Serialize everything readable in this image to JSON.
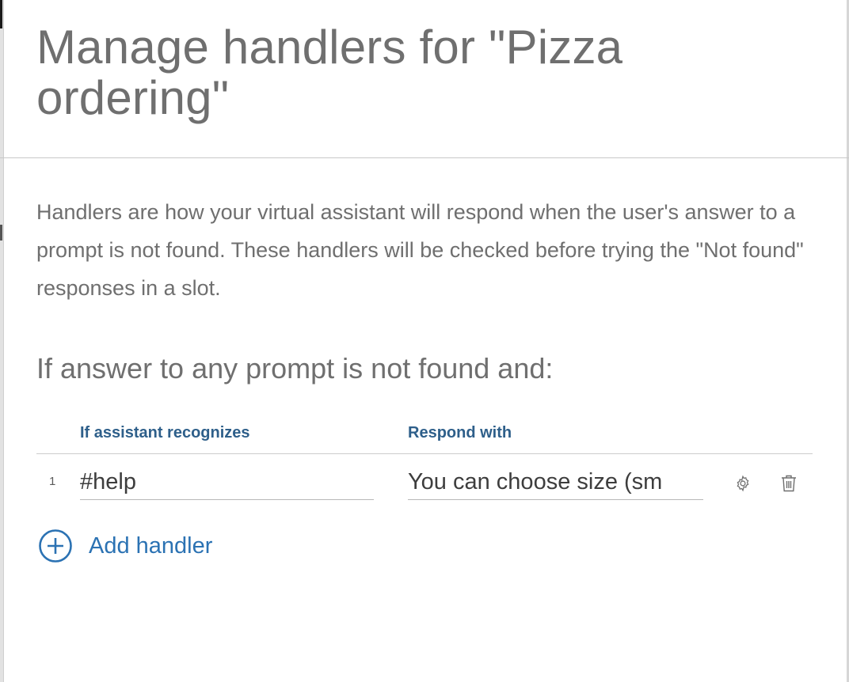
{
  "title": "Manage handlers for \"Pizza ordering\"",
  "description": "Handlers are how your virtual assistant will respond when the user's answer to a prompt is not found. These handlers will be checked before trying the \"Not found\" responses in a slot.",
  "section_heading": "If answer to any prompt is not found and:",
  "table": {
    "headers": {
      "recognizes": "If assistant recognizes",
      "respond": "Respond with"
    },
    "rows": [
      {
        "number": "1",
        "recognizes": "#help",
        "respond": "You can choose size (sm"
      }
    ]
  },
  "icons": {
    "settings": "gear-icon",
    "delete": "trash-icon",
    "add": "plus-circle-icon"
  },
  "add_handler_label": "Add handler",
  "colors": {
    "title": "#6f6f6f",
    "header_label": "#2e5f8a",
    "link": "#2b72b3"
  }
}
